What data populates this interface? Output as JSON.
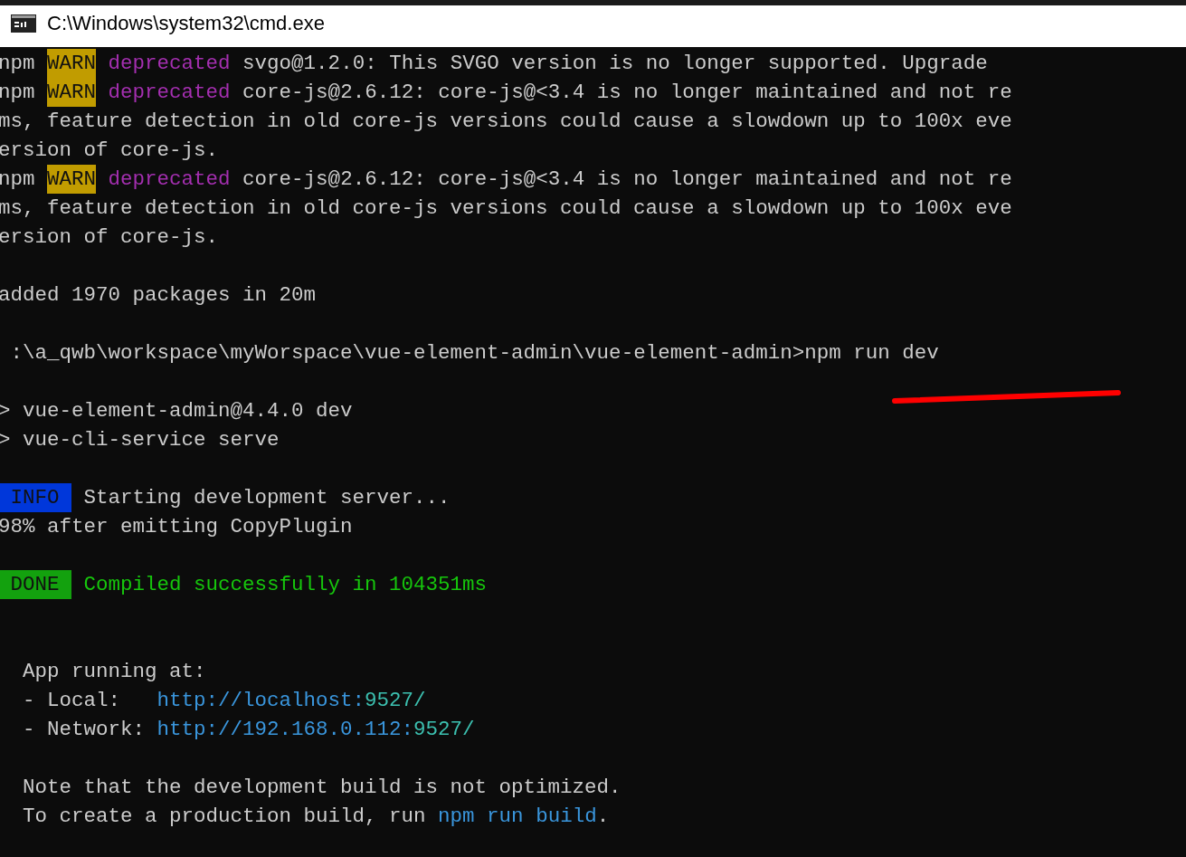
{
  "window": {
    "title": "C:\\Windows\\system32\\cmd.exe"
  },
  "lines": [
    {
      "kind": "text",
      "segments": [
        {
          "kind": "plain",
          "text": "npm "
        },
        {
          "kind": "warn",
          "text": "WARN"
        },
        {
          "kind": "deprecated",
          "text": " deprecated"
        },
        {
          "kind": "plain",
          "text": " svgo@1.2.0: This SVGO version is no longer supported. Upgrade"
        }
      ]
    },
    {
      "kind": "text",
      "segments": [
        {
          "kind": "plain",
          "text": "npm "
        },
        {
          "kind": "warn",
          "text": "WARN"
        },
        {
          "kind": "deprecated",
          "text": " deprecated"
        },
        {
          "kind": "plain",
          "text": " core-js@2.6.12: core-js@<3.4 is no longer maintained and not re"
        }
      ]
    },
    {
      "kind": "text",
      "segments": [
        {
          "kind": "plain",
          "text": "ms, feature detection in old core-js versions could cause a slowdown up to 100x eve"
        }
      ]
    },
    {
      "kind": "text",
      "segments": [
        {
          "kind": "plain",
          "text": "ersion of core-js."
        }
      ]
    },
    {
      "kind": "text",
      "segments": [
        {
          "kind": "plain",
          "text": "npm "
        },
        {
          "kind": "warn",
          "text": "WARN"
        },
        {
          "kind": "deprecated",
          "text": " deprecated"
        },
        {
          "kind": "plain",
          "text": " core-js@2.6.12: core-js@<3.4 is no longer maintained and not re"
        }
      ]
    },
    {
      "kind": "text",
      "segments": [
        {
          "kind": "plain",
          "text": "ms, feature detection in old core-js versions could cause a slowdown up to 100x eve"
        }
      ]
    },
    {
      "kind": "text",
      "segments": [
        {
          "kind": "plain",
          "text": "ersion of core-js."
        }
      ]
    },
    {
      "kind": "blank"
    },
    {
      "kind": "text",
      "segments": [
        {
          "kind": "plain",
          "text": "added 1970 packages in 20m"
        }
      ]
    },
    {
      "kind": "blank"
    },
    {
      "kind": "text",
      "segments": [
        {
          "kind": "plain",
          "text": " :\\a_qwb\\workspace\\myWorspace\\vue-element-admin\\vue-element-admin>npm run dev"
        }
      ]
    },
    {
      "kind": "blank"
    },
    {
      "kind": "text",
      "segments": [
        {
          "kind": "plain",
          "text": "> vue-element-admin@4.4.0 dev"
        }
      ]
    },
    {
      "kind": "text",
      "segments": [
        {
          "kind": "plain",
          "text": "> vue-cli-service serve"
        }
      ]
    },
    {
      "kind": "blank"
    },
    {
      "kind": "text",
      "segments": [
        {
          "kind": "info",
          "text": " INFO "
        },
        {
          "kind": "plain",
          "text": " Starting development server..."
        }
      ]
    },
    {
      "kind": "text",
      "segments": [
        {
          "kind": "plain",
          "text": "98% after emitting CopyPlugin"
        }
      ]
    },
    {
      "kind": "blank"
    },
    {
      "kind": "text",
      "segments": [
        {
          "kind": "done",
          "text": " DONE "
        },
        {
          "kind": "success",
          "text": " Compiled successfully in 104351ms"
        }
      ]
    },
    {
      "kind": "blank"
    },
    {
      "kind": "blank"
    },
    {
      "kind": "text",
      "segments": [
        {
          "kind": "plain",
          "text": "  App running at:"
        }
      ]
    },
    {
      "kind": "text",
      "segments": [
        {
          "kind": "plain",
          "text": "  - Local:   "
        },
        {
          "kind": "link",
          "text": "http://localhost:"
        },
        {
          "kind": "port",
          "text": "9527/"
        }
      ]
    },
    {
      "kind": "text",
      "segments": [
        {
          "kind": "plain",
          "text": "  - Network: "
        },
        {
          "kind": "link",
          "text": "http://192.168.0.112:"
        },
        {
          "kind": "port",
          "text": "9527/"
        }
      ]
    },
    {
      "kind": "blank"
    },
    {
      "kind": "text",
      "segments": [
        {
          "kind": "plain",
          "text": "  Note that the development build is not optimized."
        }
      ]
    },
    {
      "kind": "text",
      "segments": [
        {
          "kind": "plain",
          "text": "  To create a production build, run "
        },
        {
          "kind": "link",
          "text": "npm run build"
        },
        {
          "kind": "plain",
          "text": "."
        }
      ]
    }
  ]
}
